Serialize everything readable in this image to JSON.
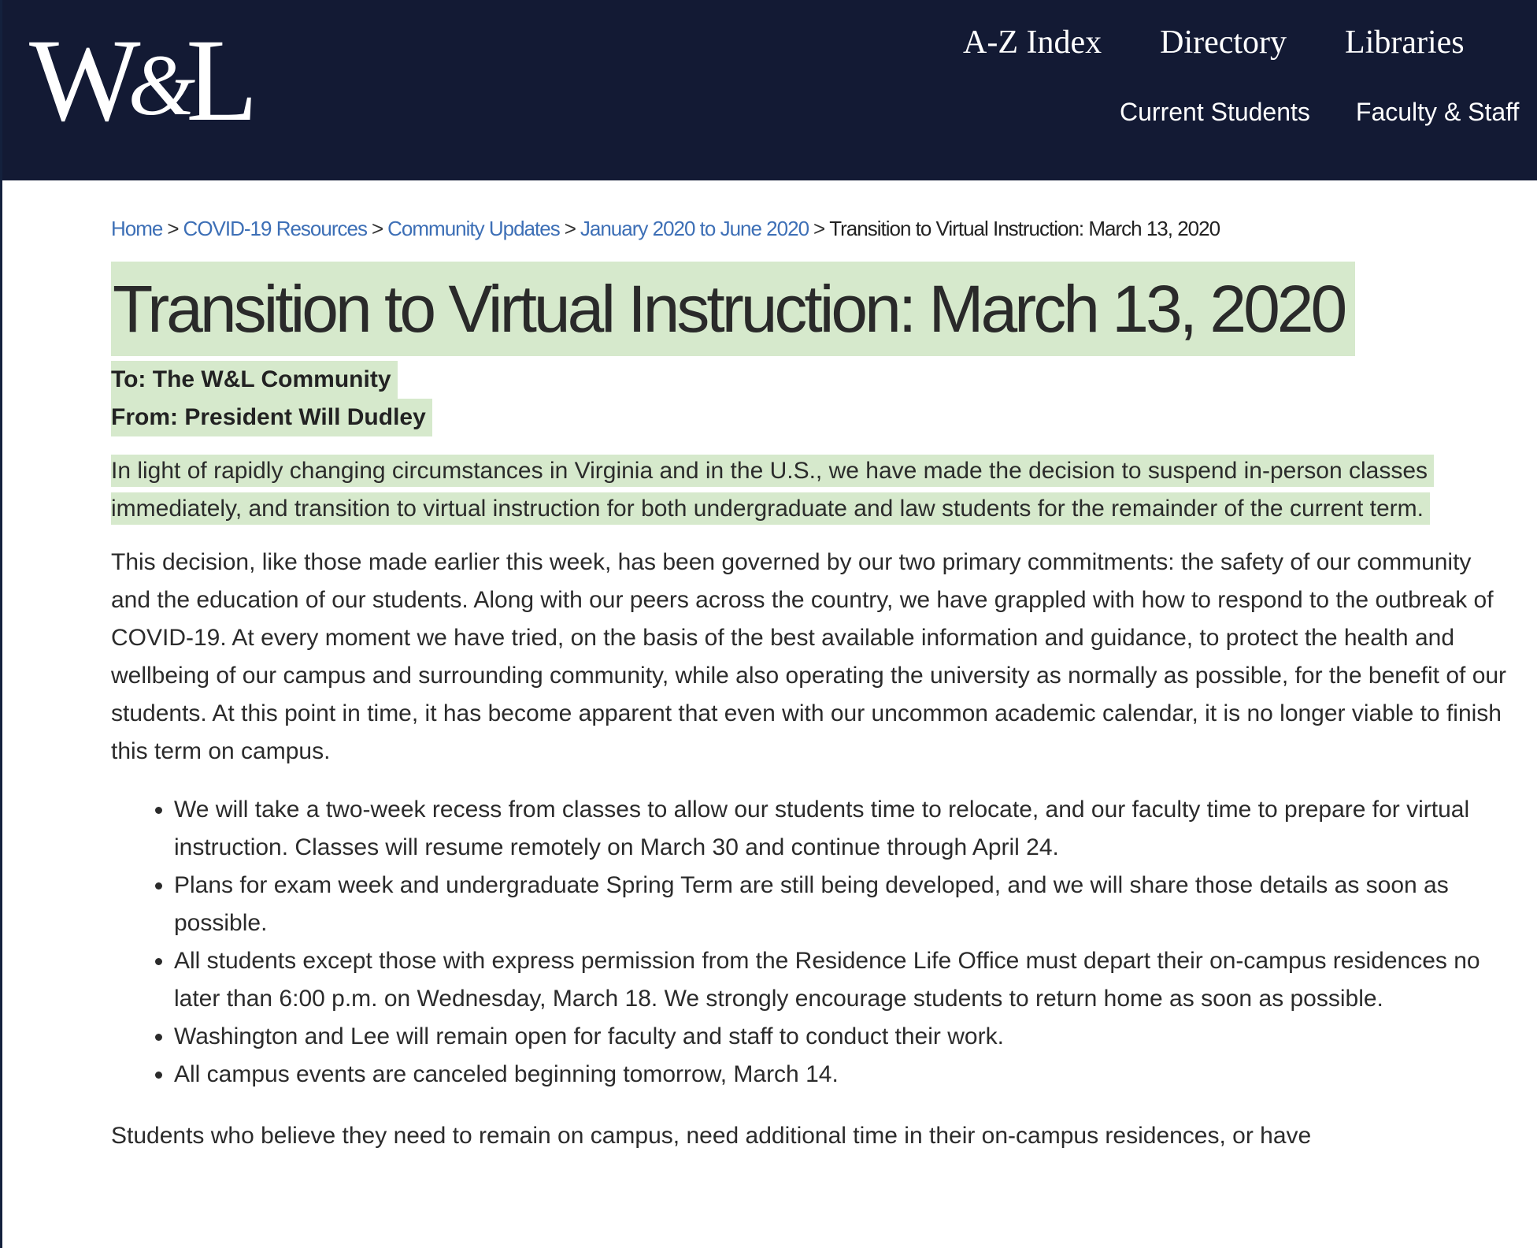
{
  "header": {
    "logo_text": "W&L",
    "utility_nav": [
      "A-Z Index",
      "Directory",
      "Libraries"
    ],
    "audience_nav": [
      "Current Students",
      "Faculty & Staff"
    ],
    "background_color": "#131a34"
  },
  "breadcrumb": {
    "items": [
      {
        "label": "Home"
      },
      {
        "label": "COVID-19 Resources"
      },
      {
        "label": "Community Updates"
      },
      {
        "label": "January 2020 to June 2020"
      }
    ],
    "separator": ">",
    "current": "Transition to Virtual Instruction: March 13, 2020",
    "link_color": "#3d6fb6"
  },
  "article": {
    "title": "Transition to Virtual Instruction: March 13, 2020",
    "to_line": "To: The W&L Community",
    "from_line": "From: President Will Dudley",
    "highlight_color": "#d6e9cc",
    "paragraph_1": "In light of rapidly changing circumstances in Virginia and in the U.S., we have made the decision to suspend in-person classes immediately, and transition to virtual instruction for both undergraduate and law students for the remainder of the current term.",
    "paragraph_2": "This decision, like those made earlier this week, has been governed by our two primary commitments: the safety of our community and the education of our students. Along with our peers across the country, we have grappled with how to respond to the outbreak of COVID-19. At every moment we have tried, on the basis of the best available information and guidance, to protect the health and wellbeing of our campus and surrounding community, while also operating the university as normally as possible, for the benefit of our students. At this point in time, it has become apparent that even with our uncommon academic calendar, it is no longer viable to finish this term on campus.",
    "bullets": [
      "We will take a two-week recess from classes to allow our students time to relocate, and our faculty time to prepare for virtual instruction. Classes will resume remotely on March 30 and continue through April 24.",
      "Plans for exam week and undergraduate Spring Term are still being developed, and we will share those details as soon as possible.",
      "All students except those with express permission from the Residence Life Office must depart their on-campus residences no later than 6:00 p.m. on Wednesday, March 18. We strongly encourage students to return home as soon as possible.",
      "Washington and Lee will remain open for faculty and staff to conduct their work.",
      "All campus events are canceled beginning tomorrow, March 14."
    ],
    "paragraph_3_partial": "Students who believe they need to remain on campus, need additional time in their on-campus residences, or have"
  }
}
